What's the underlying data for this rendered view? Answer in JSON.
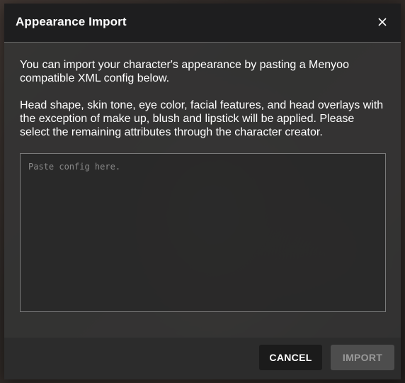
{
  "dialog": {
    "title": "Appearance Import",
    "close_icon": "close-icon",
    "paragraphs": [
      "You can import your character's appearance by pasting a Menyoo compatible XML config below.",
      "Head shape, skin tone, eye color, facial features, and head overlays with the exception of make up, blush and lipstick will be applied. Please select the remaining attributes through the character creator."
    ],
    "config_input": {
      "placeholder": "Paste config here.",
      "value": ""
    },
    "buttons": {
      "cancel_label": "CANCEL",
      "import_label": "IMPORT",
      "import_enabled": false
    }
  },
  "colors": {
    "header_bg": "#1e1e1f",
    "dialog_bg": "#343434",
    "cancel_bg": "#1b1b1b",
    "import_bg_disabled": "#4d4d4d",
    "text": "#ffffff"
  }
}
